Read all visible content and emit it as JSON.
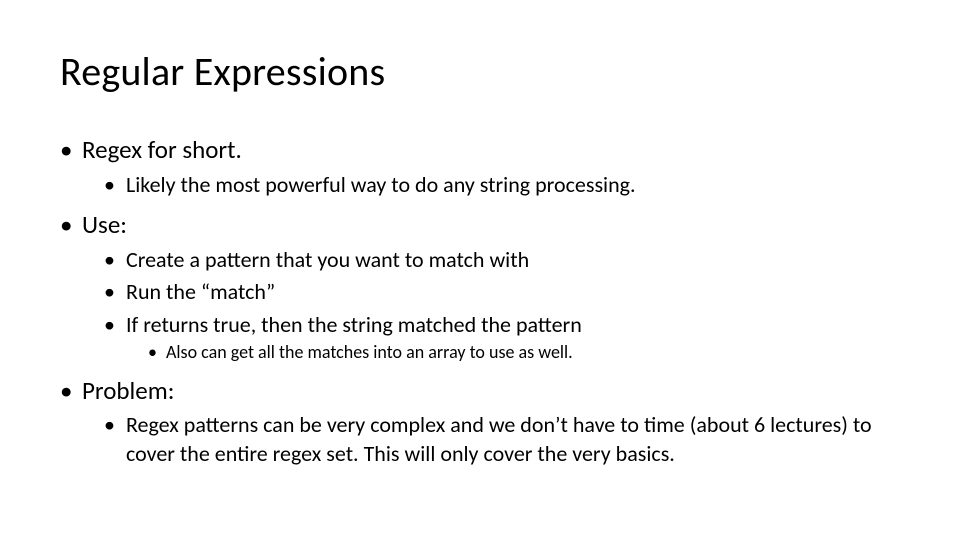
{
  "title": "Regular Expressions",
  "bullets": {
    "regex_short": "Regex for short.",
    "regex_short_sub1": "Likely the most powerful way to do any string processing.",
    "use": "Use:",
    "use_sub1": "Create a pattern that you want to match with",
    "use_sub2": "Run the “match”",
    "use_sub3": "If returns true, then the string matched the pattern",
    "use_sub3_sub1": "Also can get all the matches into an array to use as well.",
    "problem": "Problem:",
    "problem_sub1": "Regex patterns can be very complex and we don’t have to time (about 6 lectures) to cover the entire regex set.  This will only cover the very basics."
  }
}
